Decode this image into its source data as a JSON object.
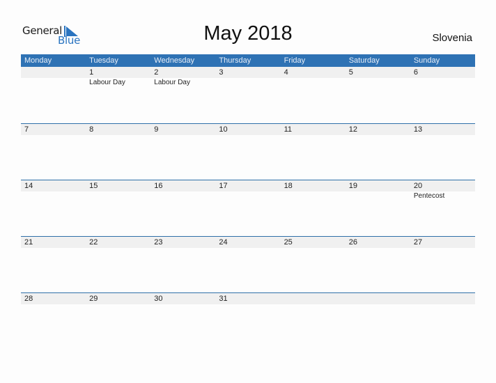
{
  "logo": {
    "word1": "General",
    "word2": "Blue"
  },
  "title": "May 2018",
  "country": "Slovenia",
  "colors": {
    "header_bg": "#2e72b4",
    "accent": "#2a74c0",
    "row_bg": "#f0f0f0"
  },
  "weekdays": [
    "Monday",
    "Tuesday",
    "Wednesday",
    "Thursday",
    "Friday",
    "Saturday",
    "Sunday"
  ],
  "weeks": [
    {
      "days": [
        "",
        "1",
        "2",
        "3",
        "4",
        "5",
        "6"
      ],
      "events": [
        "",
        "Labour Day",
        "Labour Day",
        "",
        "",
        "",
        ""
      ]
    },
    {
      "days": [
        "7",
        "8",
        "9",
        "10",
        "11",
        "12",
        "13"
      ],
      "events": [
        "",
        "",
        "",
        "",
        "",
        "",
        ""
      ]
    },
    {
      "days": [
        "14",
        "15",
        "16",
        "17",
        "18",
        "19",
        "20"
      ],
      "events": [
        "",
        "",
        "",
        "",
        "",
        "",
        "Pentecost"
      ]
    },
    {
      "days": [
        "21",
        "22",
        "23",
        "24",
        "25",
        "26",
        "27"
      ],
      "events": [
        "",
        "",
        "",
        "",
        "",
        "",
        ""
      ]
    },
    {
      "days": [
        "28",
        "29",
        "30",
        "31",
        "",
        "",
        ""
      ],
      "events": [
        "",
        "",
        "",
        "",
        "",
        "",
        ""
      ]
    }
  ]
}
